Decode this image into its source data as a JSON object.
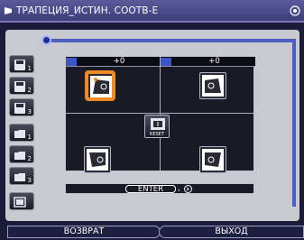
{
  "title": {
    "text": "ТРАПЕЦИЯ_ИСТИН. СООТВ-Е",
    "icon": "keystone-icon",
    "corner_icon": "settings-icon"
  },
  "side_buttons": [
    {
      "name": "save-1",
      "num": "1"
    },
    {
      "name": "save-2",
      "num": "2"
    },
    {
      "name": "save-3",
      "num": "3"
    },
    {
      "name": "load-1",
      "num": "1"
    },
    {
      "name": "load-2",
      "num": "2"
    },
    {
      "name": "load-3",
      "num": "3"
    }
  ],
  "readouts": {
    "horizontal_value": "+0",
    "vertical_value": "+0"
  },
  "corners": [
    {
      "name": "top-left",
      "active": true
    },
    {
      "name": "top-right",
      "active": false
    },
    {
      "name": "bottom-left",
      "active": false
    },
    {
      "name": "bottom-right",
      "active": false
    }
  ],
  "reset_label": "RESET",
  "enter": {
    "label": "ENTER",
    "suffix": ",",
    "icon": "enter-arrow-icon"
  },
  "bottom": {
    "back_label": "ВОЗВРАТ",
    "exit_label": "ВЫХОД"
  },
  "colors": {
    "accent_blue": "#4b5fc0",
    "active_orange": "#f08a24",
    "panel_grey": "#c9c9d0"
  }
}
